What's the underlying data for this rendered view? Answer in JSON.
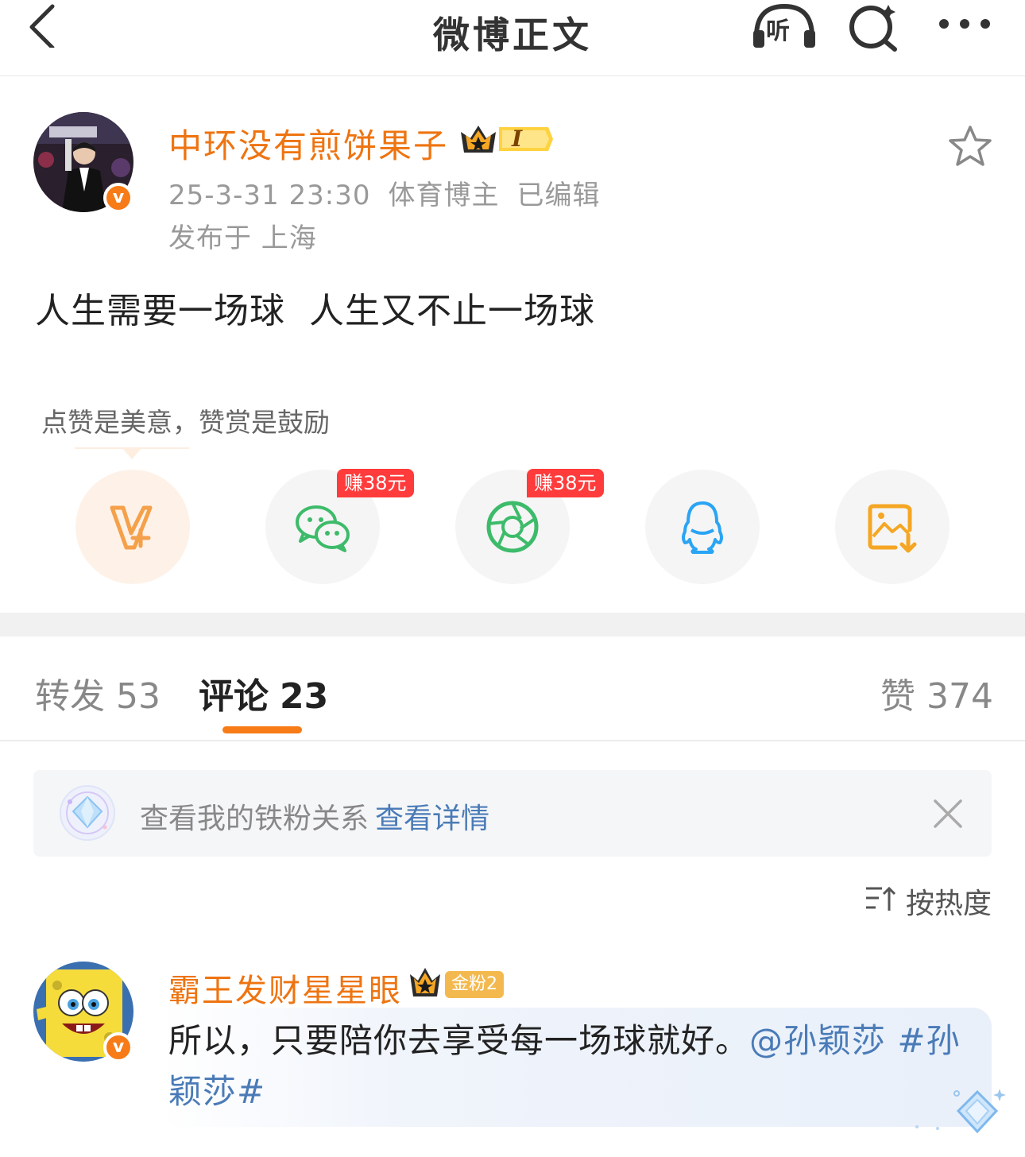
{
  "nav": {
    "title": "微博正文",
    "listen_label": "听"
  },
  "post": {
    "author": "中环没有煎饼果子",
    "level_badge": "I",
    "date": "25-3-31 23:30",
    "tag": "体育博主",
    "edited": "已编辑",
    "location": "发布于 上海",
    "text": "人生需要一场球  人生又不止一场球",
    "verified": "v"
  },
  "share": {
    "tip": "点赞是美意，赞赏是鼓励",
    "earn_wechat": "赚38元",
    "earn_moments": "赚38元"
  },
  "tabs": {
    "repost_label": "转发",
    "repost_count": "53",
    "comment_label": "评论",
    "comment_count": "23",
    "like_label": "赞",
    "like_count": "374"
  },
  "fan_banner": {
    "text": "查看我的铁粉关系",
    "link": "查看详情"
  },
  "sort": {
    "label": "按热度"
  },
  "comment": {
    "author": "霸王发财星星眼",
    "fan_badge": "金粉2",
    "verified": "v",
    "text": "所以，只要陪你去享受每一场球就好。",
    "mention": "@孙颖莎",
    "topic": " #孙颖莎#"
  },
  "colors": {
    "accent": "#f77b17",
    "name": "#ee7411",
    "link": "#4a7bb7",
    "earn_badge": "#ff3b3b"
  }
}
